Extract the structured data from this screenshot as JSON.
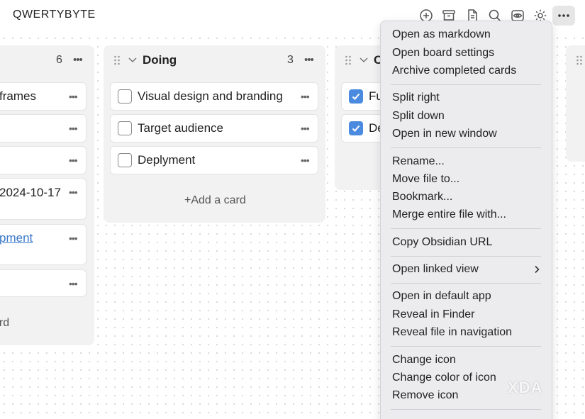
{
  "app": {
    "title": "QWERTYBYTE"
  },
  "toolbar": {
    "icons": [
      "plus-circle-icon",
      "archive-icon",
      "document-icon",
      "search-icon",
      "eye-icon",
      "gear-icon",
      "more-icon"
    ]
  },
  "lanes": [
    {
      "title": "",
      "count": "6",
      "cards": [
        {
          "text": "frames"
        },
        {
          "text": ""
        },
        {
          "text": ""
        },
        {
          "text": "2024-10-17"
        },
        {
          "text": "pment"
        },
        {
          "text": ""
        }
      ],
      "add_label": "ard"
    },
    {
      "title": "Doing",
      "count": "3",
      "cards": [
        {
          "text": "Visual design and branding",
          "checked": false
        },
        {
          "text": "Target audience",
          "checked": false
        },
        {
          "text": "Deplyment",
          "checked": false
        }
      ],
      "add_label": "+Add a card"
    },
    {
      "title": "C",
      "cards": [
        {
          "text": "Fu",
          "checked": true
        },
        {
          "text": "De",
          "checked": true
        }
      ]
    }
  ],
  "menu": {
    "groups": [
      [
        "Open as markdown",
        "Open board settings",
        "Archive completed cards"
      ],
      [
        "Split right",
        "Split down",
        "Open in new window"
      ],
      [
        "Rename...",
        "Move file to...",
        "Bookmark...",
        "Merge entire file with..."
      ],
      [
        "Copy Obsidian URL"
      ],
      [
        "Open linked view"
      ],
      [
        "Open in default app",
        "Reveal in Finder",
        "Reveal file in navigation"
      ],
      [
        "Change icon",
        "Change color of icon",
        "Remove icon"
      ]
    ]
  },
  "watermark": "XDA",
  "colors": {
    "accent": "#4a8be0",
    "lane_bg": "#f2f2f3",
    "menu_bg": "#ececee"
  }
}
